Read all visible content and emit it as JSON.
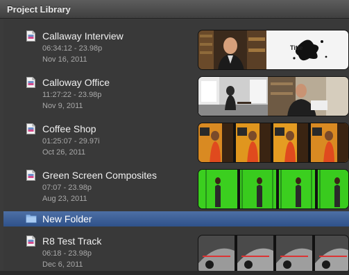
{
  "window": {
    "title": "Project Library"
  },
  "projects": [
    {
      "name": "Callaway Interview",
      "meta": "06:34:12 - 23.98p",
      "date": "Nov 16, 2011"
    },
    {
      "name": "Calloway Office",
      "meta": "11:27:22 - 23.98p",
      "date": "Nov 9, 2011"
    },
    {
      "name": "Coffee Shop",
      "meta": "01:25:07 - 29.97i",
      "date": "Oct 26, 2011"
    },
    {
      "name": "Green Screen Composites",
      "meta": "07:07 - 23.98p",
      "date": "Aug 23, 2011"
    }
  ],
  "folder": {
    "name": "New Folder",
    "icon": "folder-icon",
    "selected": true
  },
  "folder_projects": [
    {
      "name": "R8 Test Track",
      "meta": "06:18 - 23.98p",
      "date": "Dec 6, 2011"
    }
  ],
  "thumbnail_title_text": "Title",
  "colors": {
    "background": "#393939",
    "selection": "#3b5f97",
    "text_primary": "#f0f0f0",
    "text_secondary": "#a9a9a9",
    "green_screen": "#33c41a"
  }
}
